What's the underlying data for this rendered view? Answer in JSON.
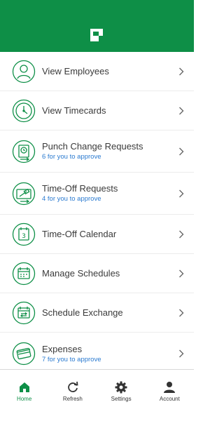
{
  "colors": {
    "brand": "#0e8f47",
    "link": "#2a7ad0",
    "text": "#3a3a3a"
  },
  "header": {
    "logo_icon": "paychex-logo-icon"
  },
  "menu": {
    "items": [
      {
        "label": "View Employees",
        "sub": "",
        "icon": "employee-icon"
      },
      {
        "label": "View Timecards",
        "sub": "",
        "icon": "clock-icon"
      },
      {
        "label": "Punch Change Requests",
        "sub": "6 for you to approve",
        "icon": "punch-change-icon"
      },
      {
        "label": "Time-Off Requests",
        "sub": "4 for you to approve",
        "icon": "time-off-icon"
      },
      {
        "label": "Time-Off Calendar",
        "sub": "",
        "icon": "calendar-icon"
      },
      {
        "label": "Manage Schedules",
        "sub": "",
        "icon": "schedule-icon"
      },
      {
        "label": "Schedule Exchange",
        "sub": "",
        "icon": "schedule-exchange-icon"
      },
      {
        "label": "Expenses",
        "sub": "7 for you to approve",
        "icon": "expenses-icon"
      }
    ]
  },
  "tabbar": {
    "tabs": [
      {
        "label": "Home",
        "icon": "home-icon",
        "active": true
      },
      {
        "label": "Refresh",
        "icon": "refresh-icon",
        "active": false
      },
      {
        "label": "Settings",
        "icon": "gear-icon",
        "active": false
      },
      {
        "label": "Account",
        "icon": "account-icon",
        "active": false
      }
    ]
  }
}
